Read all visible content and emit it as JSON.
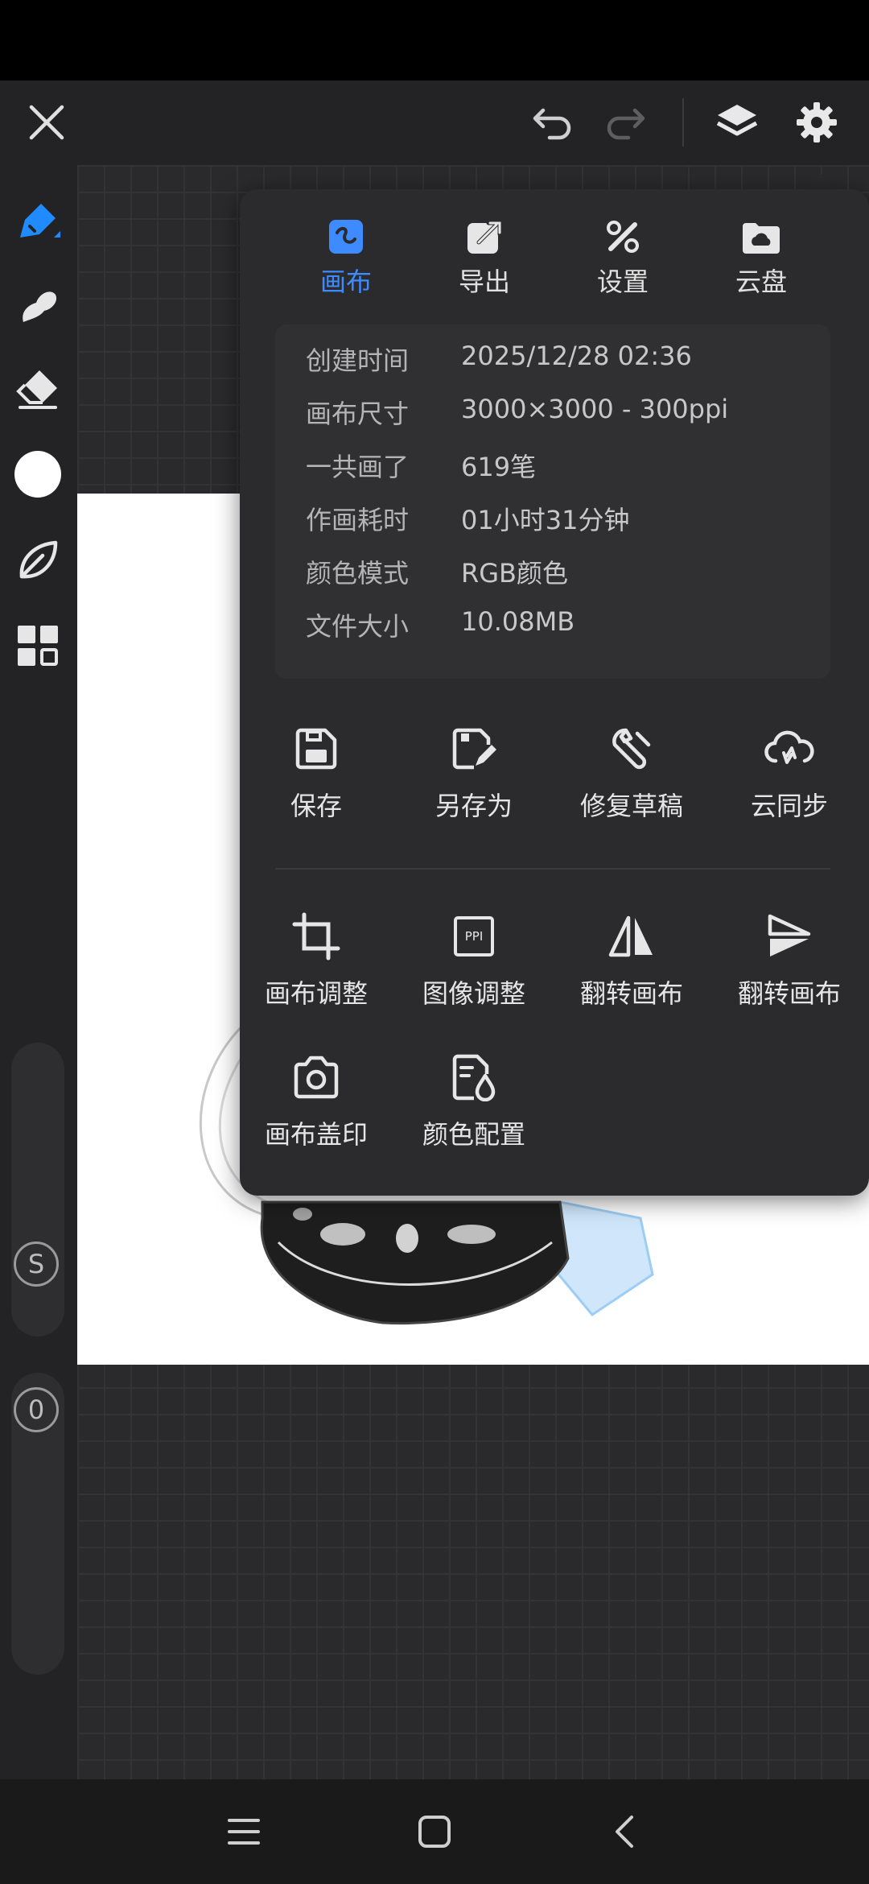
{
  "colors": {
    "accent": "#3d8bff",
    "panel_bg": "#2b2b2d",
    "canvas": "#ffffff"
  },
  "top_bar": {
    "close_icon": "close-icon",
    "undo_icon": "undo-icon",
    "redo_icon": "redo-icon",
    "layers_icon": "layers-icon",
    "settings_icon": "gear-icon"
  },
  "left_toolbar": {
    "tools": [
      "pen-tool-icon",
      "smudge-icon",
      "eraser-icon",
      "color-picker",
      "leaf-brush-icon",
      "grid-icon"
    ],
    "size_slider_label": "S",
    "opacity_slider_label": "0"
  },
  "panel": {
    "tabs": [
      {
        "label": "画布",
        "icon": "canvas-tab-icon"
      },
      {
        "label": "导出",
        "icon": "export-icon"
      },
      {
        "label": "设置",
        "icon": "tools-icon"
      },
      {
        "label": "云盘",
        "icon": "cloud-folder-icon"
      }
    ],
    "info": [
      {
        "key": "创建时间",
        "value": "2025/12/28 02:36"
      },
      {
        "key": "画布尺寸",
        "value": "3000×3000 - 300ppi"
      },
      {
        "key": "一共画了",
        "value": "619笔"
      },
      {
        "key": "作画耗时",
        "value": "01小时31分钟"
      },
      {
        "key": "颜色模式",
        "value": "RGB颜色"
      },
      {
        "key": "文件大小",
        "value": "10.08MB"
      }
    ],
    "actions_row1": [
      "保存",
      "另存为",
      "修复草稿",
      "云同步"
    ],
    "actions_row2": [
      "画布调整",
      "图像调整",
      "翻转画布",
      "翻转画布"
    ],
    "actions_row3": [
      "画布盖印",
      "颜色配置"
    ],
    "ppi_icon_text": "PPI"
  },
  "bottom_nav": {
    "menu_icon": "menu-icon",
    "home_icon": "home-icon",
    "back_icon": "back-icon"
  }
}
